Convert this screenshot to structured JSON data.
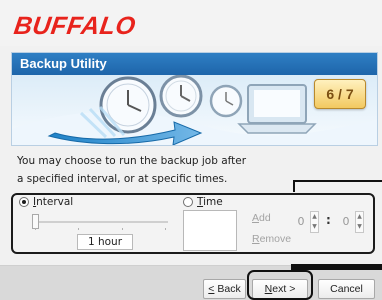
{
  "brand": {
    "name": "BUFFALO"
  },
  "window": {
    "title": "Backup Utility",
    "step": "6 / 7"
  },
  "content": {
    "description_line_1": "You may choose to run the backup job after",
    "description_line_2": "a specified interval, or at specific times."
  },
  "schedule": {
    "interval_label": "Interval",
    "time_label": "Time",
    "interval_selected": true,
    "interval_value": "1 hour",
    "slider_position": 0,
    "time_entries": [],
    "add_label": "Add",
    "remove_label": "Remove",
    "hour_value": "0",
    "minute_value": "0",
    "separator": ":"
  },
  "navigation": {
    "back_label": "< Back",
    "next_label": "Next >",
    "cancel_label": "Cancel"
  },
  "colors": {
    "brand": "#e8231c",
    "header": "#1e65aa",
    "step_badge": "#f3c960",
    "annotation": "#111111"
  },
  "icons": {
    "illustration": "clocks-and-laptop-illustration",
    "spinner_up": "chevron-up-icon",
    "spinner_down": "chevron-down-icon"
  }
}
